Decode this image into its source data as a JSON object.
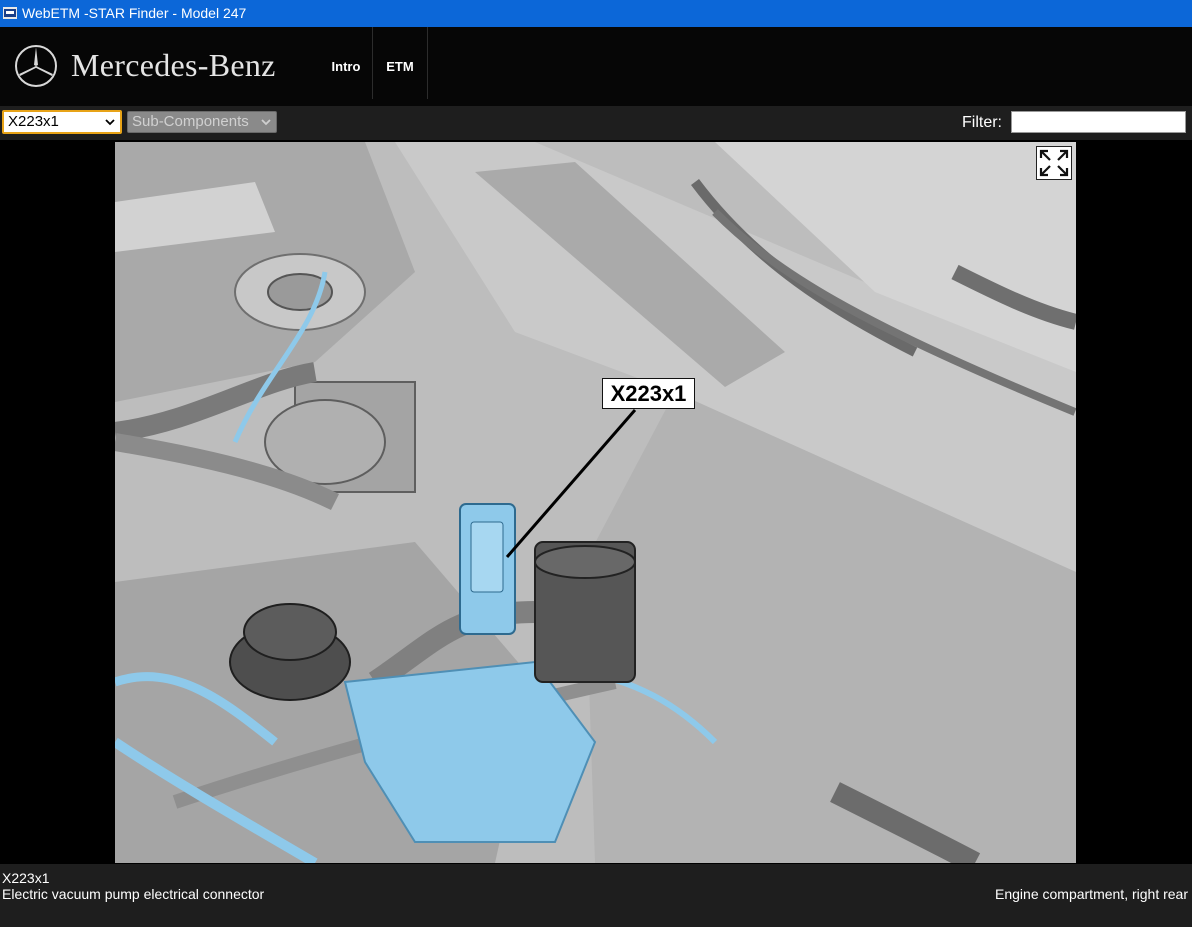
{
  "window": {
    "title": "WebETM -STAR Finder - Model 247"
  },
  "header": {
    "brand": "Mercedes-Benz",
    "nav": [
      {
        "label": "Intro"
      },
      {
        "label": "ETM"
      }
    ]
  },
  "toolbar": {
    "component_select": {
      "value": "X223x1"
    },
    "subcomponent_select": {
      "value": "Sub-Components"
    },
    "filter": {
      "label": "Filter:",
      "value": ""
    }
  },
  "viewer": {
    "callout_label": "X223x1",
    "expand_icon": "expand-arrows-icon",
    "highlight_color": "#8ec9ea"
  },
  "footer": {
    "code": "X223x1",
    "description": "Electric vacuum pump electrical connector",
    "location": "Engine compartment, right rear"
  },
  "colors": {
    "titlebar": "#0c67d8",
    "header": "#060606",
    "toolbar": "#1e1e1e",
    "select_focus": "#e8a317"
  }
}
